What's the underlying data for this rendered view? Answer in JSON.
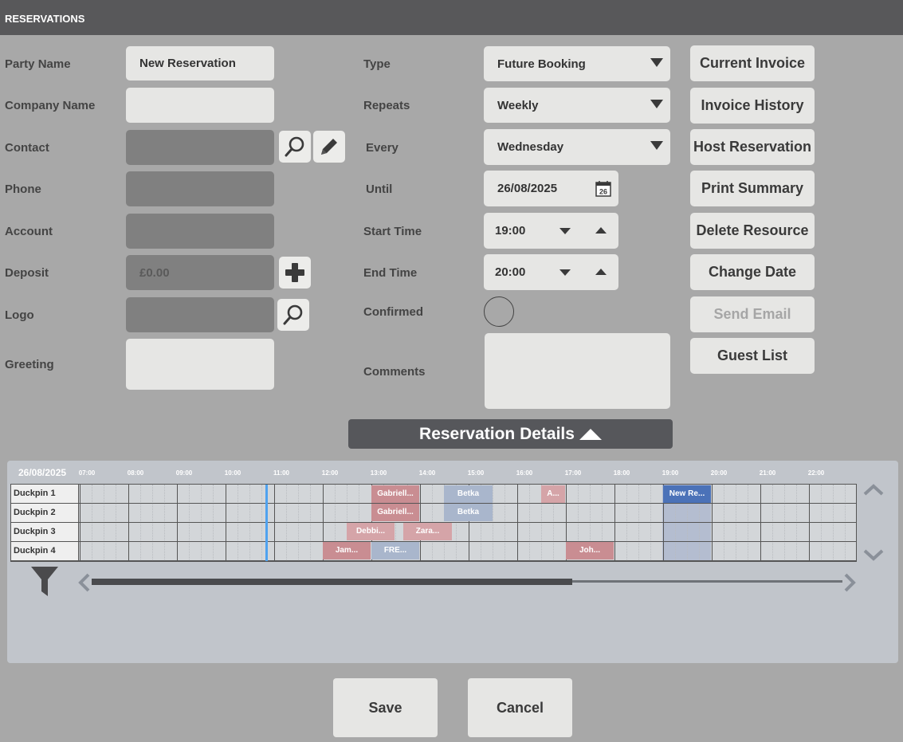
{
  "window": {
    "title": "RESERVATIONS"
  },
  "left": {
    "party_name": {
      "label": "Party Name",
      "value": "New Reservation"
    },
    "company_name": {
      "label": "Company Name",
      "value": ""
    },
    "contact": {
      "label": "Contact",
      "value": ""
    },
    "phone": {
      "label": "Phone",
      "value": ""
    },
    "account": {
      "label": "Account",
      "value": ""
    },
    "deposit": {
      "label": "Deposit",
      "value": "£0.00"
    },
    "logo": {
      "label": "Logo",
      "value": ""
    },
    "greeting": {
      "label": "Greeting",
      "value": ""
    }
  },
  "middle": {
    "type": {
      "label": "Type",
      "value": "Future Booking"
    },
    "repeats": {
      "label": "Repeats",
      "value": "Weekly"
    },
    "every": {
      "label": "Every",
      "value": "Wednesday"
    },
    "until": {
      "label": "Until",
      "value": "26/08/2025",
      "icon_text": "26"
    },
    "start_time": {
      "label": "Start Time",
      "value": "19:00"
    },
    "end_time": {
      "label": "End Time",
      "value": "20:00"
    },
    "confirmed": {
      "label": "Confirmed",
      "checked": false
    },
    "comments": {
      "label": "Comments",
      "value": ""
    }
  },
  "actions": {
    "current_invoice": "Current Invoice",
    "invoice_history": "Invoice History",
    "host_reservation": "Host Reservation",
    "print_summary": "Print Summary",
    "delete_resource": "Delete Resource",
    "change_date": "Change Date",
    "send_email": "Send Email",
    "guest_list": "Guest List"
  },
  "details_bar": {
    "label": "Reservation Details"
  },
  "schedule": {
    "date": "26/08/2025",
    "hours": [
      "07:00",
      "08:00",
      "09:00",
      "10:00",
      "11:00",
      "12:00",
      "13:00",
      "14:00",
      "15:00",
      "16:00",
      "17:00",
      "18:00",
      "19:00",
      "20:00",
      "21:00",
      "22:00"
    ],
    "lanes": [
      "Duckpin 1",
      "Duckpin 2",
      "Duckpin 3",
      "Duckpin 4"
    ],
    "bookings": {
      "lane1": [
        "Gabriell...",
        "Betka",
        "A...",
        "New Re..."
      ],
      "lane2": [
        "Gabriell...",
        "Betka"
      ],
      "lane3": [
        "Debbi...",
        "Zara..."
      ],
      "lane4": [
        "Jam...",
        "FRE...",
        "Joh..."
      ]
    },
    "scrollbar_position": 0.64
  },
  "footer": {
    "save": "Save",
    "cancel": "Cancel"
  },
  "colors": {
    "titlebar": "#58585a",
    "background": "#a8a8a8",
    "booking_pink": "#d5a4a8",
    "booking_blue": "#a9b6cc",
    "booking_current": "#4b72b8",
    "now_line": "#4fa2ef"
  }
}
